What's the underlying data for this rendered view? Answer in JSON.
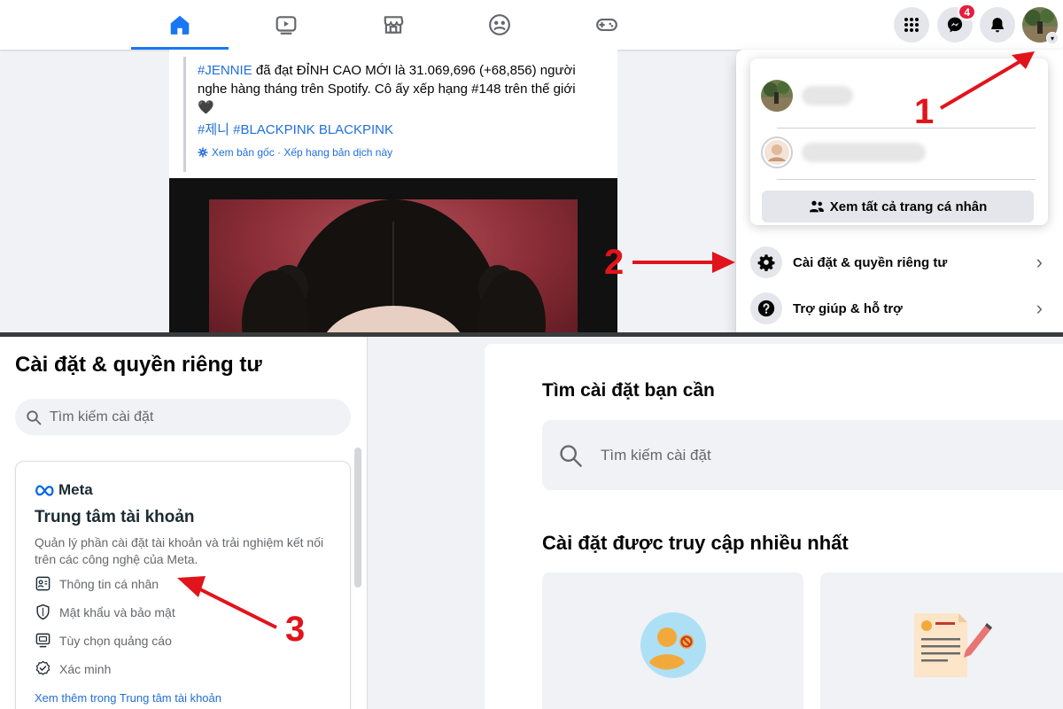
{
  "nav": {
    "tabs": [
      {
        "name": "home",
        "active": true
      },
      {
        "name": "watch",
        "active": false
      },
      {
        "name": "marketplace",
        "active": false
      },
      {
        "name": "groups",
        "active": false
      },
      {
        "name": "gaming",
        "active": false
      }
    ],
    "messenger_badge": "4"
  },
  "post": {
    "hashtag_jennie": "#JENNIE",
    "text": " đã đạt ĐỈNH CAO MỚI là 31.069,696 (+68,856) người nghe hàng tháng trên Spotify. Cô ấy xếp hạng #148 trên thế giới 🖤",
    "hashtags": "#제니 #BLACKPINK BLACKPINK",
    "translation_meta": "Xem bản gốc · Xếp hạng bản dịch này"
  },
  "account_menu": {
    "see_all_profiles": "Xem tất cả trang cá nhân",
    "settings_privacy": "Cài đặt & quyền riêng tư",
    "help_support": "Trợ giúp & hỗ trợ"
  },
  "settings_sidebar": {
    "title": "Cài đặt & quyền riêng tư",
    "search_placeholder": "Tìm kiếm cài đặt",
    "meta_logo_text": "Meta",
    "accounts_center_title": "Trung tâm tài khoản",
    "accounts_center_desc": "Quản lý phần cài đặt tài khoản và trải nghiệm kết nối trên các công nghệ của Meta.",
    "items": [
      {
        "label": "Thông tin cá nhân",
        "icon": "id-card-icon"
      },
      {
        "label": "Mật khẩu và bảo mật",
        "icon": "shield-icon"
      },
      {
        "label": "Tùy chọn quảng cáo",
        "icon": "ad-monitor-icon"
      },
      {
        "label": "Xác minh",
        "icon": "verified-check-icon"
      }
    ],
    "see_more_link": "Xem thêm trong Trung tâm tài khoản"
  },
  "settings_main": {
    "find_title": "Tìm cài đặt bạn cần",
    "search_placeholder": "Tìm kiếm cài đặt",
    "most_accessed_title": "Cài đặt được truy cập nhiều nhất"
  },
  "annotations": {
    "step1": "1",
    "step2": "2",
    "step3": "3",
    "arrow_color": "#e1141b"
  },
  "colors": {
    "brand_blue": "#1877f2",
    "link_blue": "#216fdb",
    "badge_red": "#e41e3f"
  }
}
